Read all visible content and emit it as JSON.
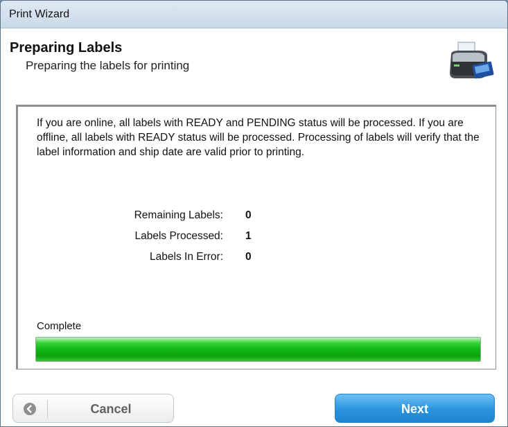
{
  "window": {
    "title": "Print Wizard"
  },
  "header": {
    "title": "Preparing Labels",
    "subtitle": "Preparing the labels for printing",
    "icon": "printer-icon"
  },
  "main": {
    "description": "If you are online, all labels with READY and PENDING status will be processed.  If you are offline, all labels with READY status will be processed.  Processing of labels will verify that the label information and ship date are valid prior to printing.",
    "stats": [
      {
        "label": "Remaining Labels:",
        "value": "0"
      },
      {
        "label": "Labels Processed:",
        "value": "1"
      },
      {
        "label": "Labels In Error:",
        "value": "0"
      }
    ],
    "progress": {
      "label": "Complete",
      "percent": 100,
      "color": "#16b416"
    }
  },
  "footer": {
    "cancel_label": "Cancel",
    "next_label": "Next",
    "back_icon": "back-arrow-icon"
  }
}
